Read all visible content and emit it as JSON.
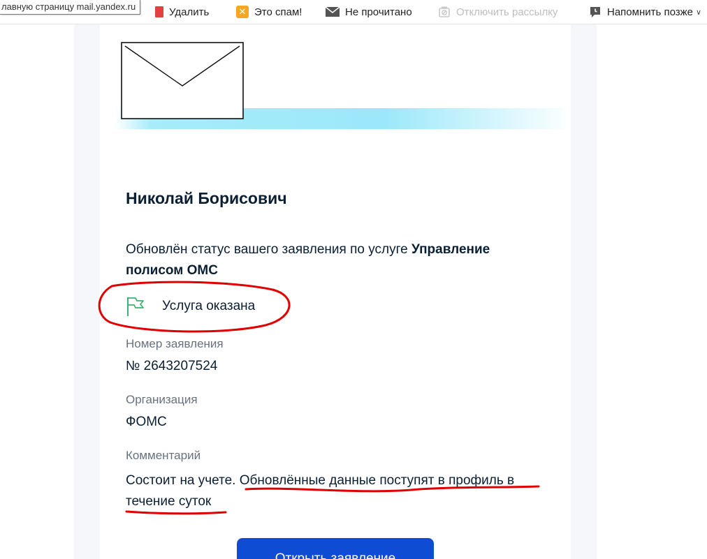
{
  "tooltip": "лавную страницу mail.yandex.ru",
  "toolbar": {
    "delete": "Удалить",
    "spam": "Это спам!",
    "unread": "Не прочитано",
    "unsubscribe": "Отключить рассылку",
    "remind": "Напомнить позже",
    "spam_icon_glyph": "✕"
  },
  "email": {
    "greeting": "Николай Борисович",
    "status_prefix": "Обновлён статус вашего заявления по услуге ",
    "service_name": "Управление полисом ОМС",
    "result": "Услуга оказана",
    "number_label": "Номер заявления",
    "number_value": "№ 2643207524",
    "org_label": "Организация",
    "org_value": "ФОМС",
    "comment_label": "Комментарий",
    "comment_value": "Состоит на учете. Обновлённые данные поступят в профиль в течение суток",
    "button": "Открыть заявление"
  },
  "colors": {
    "accent_button": "#0d4cd3",
    "annotation_red": "#e00000",
    "flag_green": "#3cb371",
    "gradient_cyan": "#a6ecfb"
  },
  "icons": [
    "trash-icon",
    "spam-icon",
    "mail-icon",
    "unsubscribe-icon",
    "remind-icon",
    "envelope-icon",
    "flag-icon"
  ]
}
